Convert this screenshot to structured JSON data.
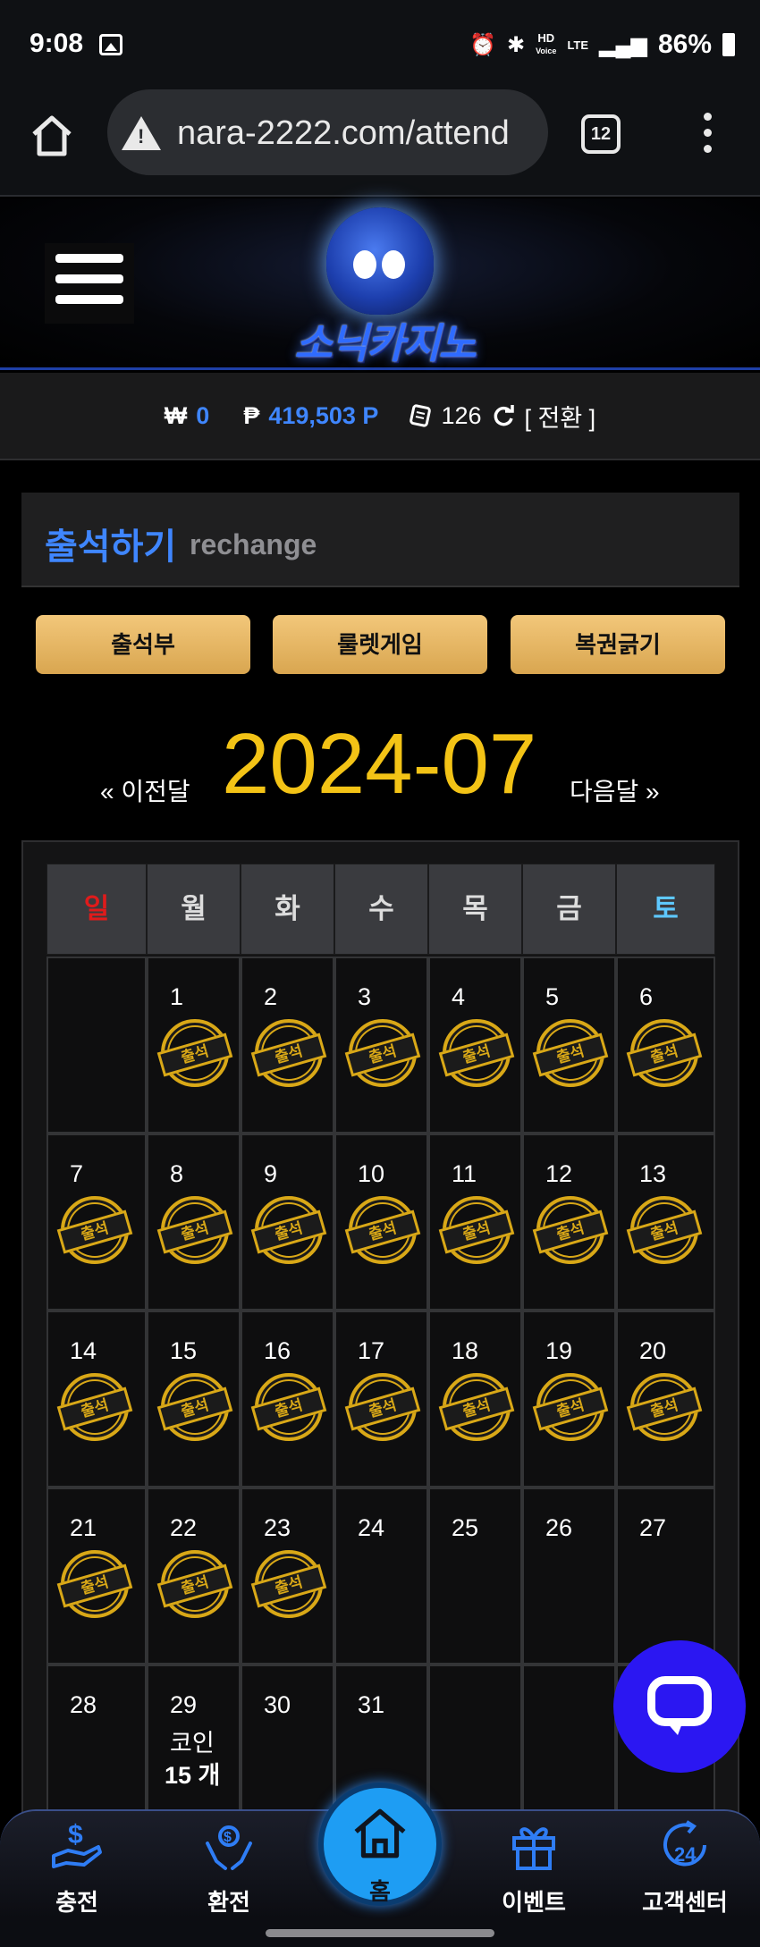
{
  "status_bar": {
    "time": "9:08",
    "network_hd": "HD",
    "network_voice": "Voice",
    "network_lte": "LTE",
    "battery": "86%"
  },
  "browser": {
    "url": "nara-2222.com/attend",
    "tab_count": "12"
  },
  "site": {
    "logo_text": "소닉카지노"
  },
  "balance": {
    "won_symbol": "₩",
    "won_value": "0",
    "point_symbol": "₱",
    "point_value": "419,503 P",
    "ticket_value": "126",
    "switch_label": "[ 전환 ]"
  },
  "page_title": {
    "main": "출석하기",
    "sub": "rechange"
  },
  "tabs": [
    {
      "label": "출석부"
    },
    {
      "label": "룰렛게임"
    },
    {
      "label": "복권긁기"
    }
  ],
  "month_nav": {
    "prev": "« 이전달",
    "current": "2024-07",
    "next": "다음달 »"
  },
  "calendar": {
    "weekdays": [
      "일",
      "월",
      "화",
      "수",
      "목",
      "금",
      "토"
    ],
    "weekday_colors": {
      "sunday": "#e01b1b",
      "saturday": "#5ec8ff",
      "default": "#dddddd"
    },
    "stamp_label": "출석",
    "days": [
      {
        "day": "1",
        "stamped": true
      },
      {
        "day": "2",
        "stamped": true
      },
      {
        "day": "3",
        "stamped": true
      },
      {
        "day": "4",
        "stamped": true
      },
      {
        "day": "5",
        "stamped": true
      },
      {
        "day": "6",
        "stamped": true
      },
      {
        "day": "7",
        "stamped": true
      },
      {
        "day": "8",
        "stamped": true
      },
      {
        "day": "9",
        "stamped": true
      },
      {
        "day": "10",
        "stamped": true
      },
      {
        "day": "11",
        "stamped": true
      },
      {
        "day": "12",
        "stamped": true
      },
      {
        "day": "13",
        "stamped": true
      },
      {
        "day": "14",
        "stamped": true
      },
      {
        "day": "15",
        "stamped": true
      },
      {
        "day": "16",
        "stamped": true
      },
      {
        "day": "17",
        "stamped": true
      },
      {
        "day": "18",
        "stamped": true
      },
      {
        "day": "19",
        "stamped": true
      },
      {
        "day": "20",
        "stamped": true
      },
      {
        "day": "21",
        "stamped": true
      },
      {
        "day": "22",
        "stamped": true
      },
      {
        "day": "23",
        "stamped": true
      },
      {
        "day": "24",
        "stamped": false
      },
      {
        "day": "25",
        "stamped": false
      },
      {
        "day": "26",
        "stamped": false
      },
      {
        "day": "27",
        "stamped": false
      },
      {
        "day": "28",
        "stamped": false
      },
      {
        "day": "29",
        "stamped": false,
        "coin_label": "코인",
        "coin_count": "15 개"
      },
      {
        "day": "30",
        "stamped": false
      },
      {
        "day": "31",
        "stamped": false
      }
    ]
  },
  "bottom_nav": [
    {
      "label": "충전",
      "icon": "deposit-hand-icon"
    },
    {
      "label": "환전",
      "icon": "exchange-hand-icon"
    },
    {
      "label": "홈",
      "icon": "home-icon"
    },
    {
      "label": "이벤트",
      "icon": "gift-icon"
    },
    {
      "label": "고객센터",
      "icon": "support-24-icon"
    }
  ],
  "colors": {
    "accent_blue": "#3f86ff",
    "gold": "#f3c316",
    "stamp_gold": "#d9a817",
    "chat_button": "#2b17f2",
    "home_button": "#1e9df3"
  }
}
